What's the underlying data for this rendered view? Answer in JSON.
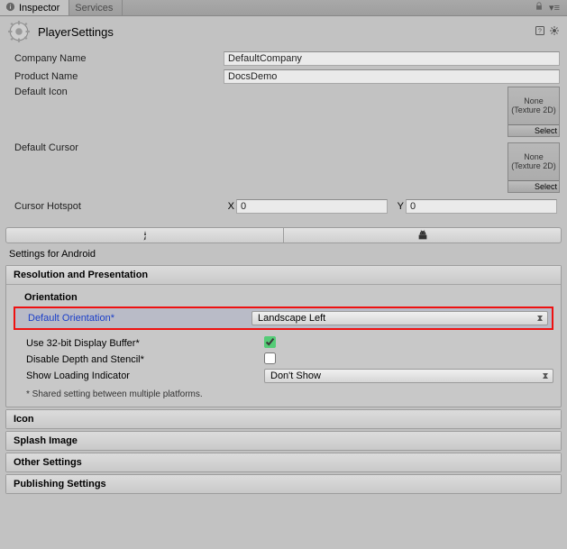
{
  "tabs": {
    "inspector": "Inspector",
    "services": "Services"
  },
  "header": {
    "title": "PlayerSettings"
  },
  "fields": {
    "companyName": {
      "label": "Company Name",
      "value": "DefaultCompany"
    },
    "productName": {
      "label": "Product Name",
      "value": "DocsDemo"
    },
    "defaultIcon": {
      "label": "Default Icon",
      "none": "None\n(Texture 2D)",
      "select": "Select"
    },
    "defaultCursor": {
      "label": "Default Cursor",
      "none": "None\n(Texture 2D)",
      "select": "Select"
    },
    "cursorHotspot": {
      "label": "Cursor Hotspot",
      "xlabel": "X",
      "x": "0",
      "ylabel": "Y",
      "y": "0"
    }
  },
  "settingsFor": "Settings for Android",
  "sections": {
    "resolution": {
      "title": "Resolution and Presentation",
      "orientation": "Orientation",
      "defaultOrientation": {
        "label": "Default Orientation*",
        "value": "Landscape Left"
      },
      "use32": "Use 32-bit Display Buffer*",
      "use32checked": true,
      "disableDepth": "Disable Depth and Stencil*",
      "disableDepthChecked": false,
      "showLoading": {
        "label": "Show Loading Indicator",
        "value": "Don't Show"
      },
      "footnote": "* Shared setting between multiple platforms."
    },
    "icon": "Icon",
    "splash": "Splash Image",
    "other": "Other Settings",
    "publishing": "Publishing Settings"
  }
}
